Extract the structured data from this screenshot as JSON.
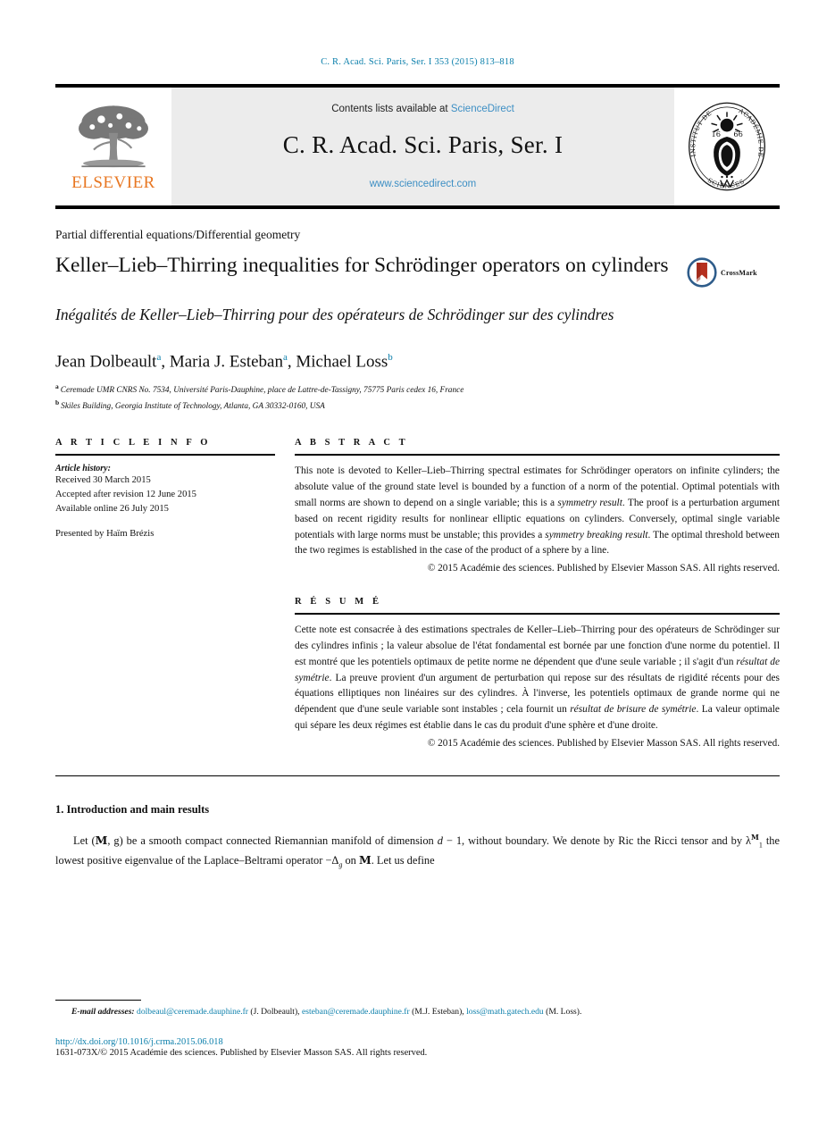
{
  "running_head": "C. R. Acad. Sci. Paris, Ser. I 353 (2015) 813–818",
  "masthead": {
    "publisher_name": "ELSEVIER",
    "contents_prefix": "Contents lists available at",
    "contents_link": "ScienceDirect",
    "journal_title": "C. R. Acad. Sci. Paris, Ser. I",
    "journal_url": "www.sciencedirect.com",
    "seal_outer_text_left": "INSTITUT DE FRANCE",
    "seal_outer_text_right": "ACADÉMIE DES",
    "seal_bottom_text": "SCIENCES",
    "seal_year": "1666"
  },
  "article": {
    "subject": "Partial differential equations/Differential geometry",
    "title": "Keller–Lieb–Thirring inequalities for Schrödinger operators on cylinders",
    "french_title": "Inégalités de Keller–Lieb–Thirring pour des opérateurs de Schrödinger sur des cylindres",
    "crossmark_label": "CrossMark"
  },
  "authors": {
    "list": "Jean Dolbeault ᵃ, Maria J. Esteban ᵃ, Michael Loss ᵇ",
    "names": [
      {
        "name": "Jean Dolbeault",
        "mark": "a"
      },
      {
        "name": "Maria J. Esteban",
        "mark": "a"
      },
      {
        "name": "Michael Loss",
        "mark": "b"
      }
    ],
    "affiliations": [
      {
        "mark": "a",
        "text": "Ceremade UMR CNRS No. 7534, Université Paris-Dauphine, place de Lattre-de-Tassigny, 75775 Paris cedex 16, France"
      },
      {
        "mark": "b",
        "text": "Skiles Building, Georgia Institute of Technology, Atlanta, GA 30332-0160, USA"
      }
    ]
  },
  "article_info": {
    "heading": "A R T I C L E   I N F O",
    "history_label": "Article history:",
    "received": "Received 30 March 2015",
    "accepted": "Accepted after revision 12 June 2015",
    "available": "Available online 26 July 2015",
    "presented_by": "Presented by Haïm Brézis"
  },
  "abstract": {
    "heading": "A B S T R A C T",
    "text_1": "This note is devoted to Keller–Lieb–Thirring spectral estimates for Schrödinger operators on infinite cylinders; the absolute value of the ground state level is bounded by a function of a norm of the potential. Optimal potentials with small norms are shown to depend on a single variable; this is a ",
    "emph_1": "symmetry result",
    "text_2": ". The proof is a perturbation argument based on recent rigidity results for nonlinear elliptic equations on cylinders. Conversely, optimal single variable potentials with large norms must be unstable; this provides a ",
    "emph_2": "symmetry breaking result",
    "text_3": ". The optimal threshold between the two regimes is established in the case of the product of a sphere by a line.",
    "copyright": "© 2015 Académie des sciences. Published by Elsevier Masson SAS. All rights reserved."
  },
  "resume": {
    "heading": "R É S U M É",
    "text_1": "Cette note est consacrée à des estimations spectrales de Keller–Lieb–Thirring pour des opérateurs de Schrödinger sur des cylindres infinis ; la valeur absolue de l'état fondamental est bornée par une fonction d'une norme du potentiel. Il est montré que les potentiels optimaux de petite norme ne dépendent que d'une seule variable ; il s'agit d'un ",
    "emph_1": "résultat de symétrie",
    "text_2": ". La preuve provient d'un argument de perturbation qui repose sur des résultats de rigidité récents pour des équations elliptiques non linéaires sur des cylindres. À l'inverse, les potentiels optimaux de grande norme qui ne dépendent que d'une seule variable sont instables ; cela fournit un ",
    "emph_2": "résultat de brisure de symétrie",
    "text_3": ". La valeur optimale qui sépare les deux régimes est établie dans le cas du produit d'une sphère et d'une droite.",
    "copyright": "© 2015 Académie des sciences. Published by Elsevier Masson SAS. All rights reserved."
  },
  "introduction": {
    "section_heading": "1. Introduction and main results",
    "paragraph_part_1": "Let (",
    "manifold_symbol": "M",
    "paragraph_part_2": ", g) be a smooth compact connected Riemannian manifold of dimension ",
    "dimension_symbol": "d",
    "paragraph_part_3": " − 1, without boundary. We denote by Ric the Ricci tensor and by λ",
    "eigenvalue_sub": "1",
    "eigenvalue_sup": "M",
    "paragraph_part_4": " the lowest positive eigenvalue of the Laplace–Beltrami operator −Δ",
    "laplacian_sub": "g",
    "paragraph_part_5": " on ",
    "paragraph_part_6": ". Let us define"
  },
  "footer": {
    "email_label": "E-mail addresses:",
    "emails": [
      {
        "address": "dolbeaul@ceremade.dauphine.fr",
        "owner": "(J. Dolbeault)"
      },
      {
        "address": "esteban@ceremade.dauphine.fr",
        "owner": "(M.J. Esteban)"
      },
      {
        "address": "loss@math.gatech.edu",
        "owner": "(M. Loss)"
      }
    ],
    "doi": "http://dx.doi.org/10.1016/j.crma.2015.06.018",
    "issn_line": "1631-073X/© 2015 Académie des sciences. Published by Elsevier Masson SAS. All rights reserved."
  },
  "colors": {
    "link": "#0b7fab",
    "sciencedirect": "#3d8fc4",
    "elsevier_orange": "#e87722",
    "masthead_bg": "#ececec",
    "crossmark_blue": "#2e5c8a",
    "crossmark_red": "#b5301f"
  }
}
